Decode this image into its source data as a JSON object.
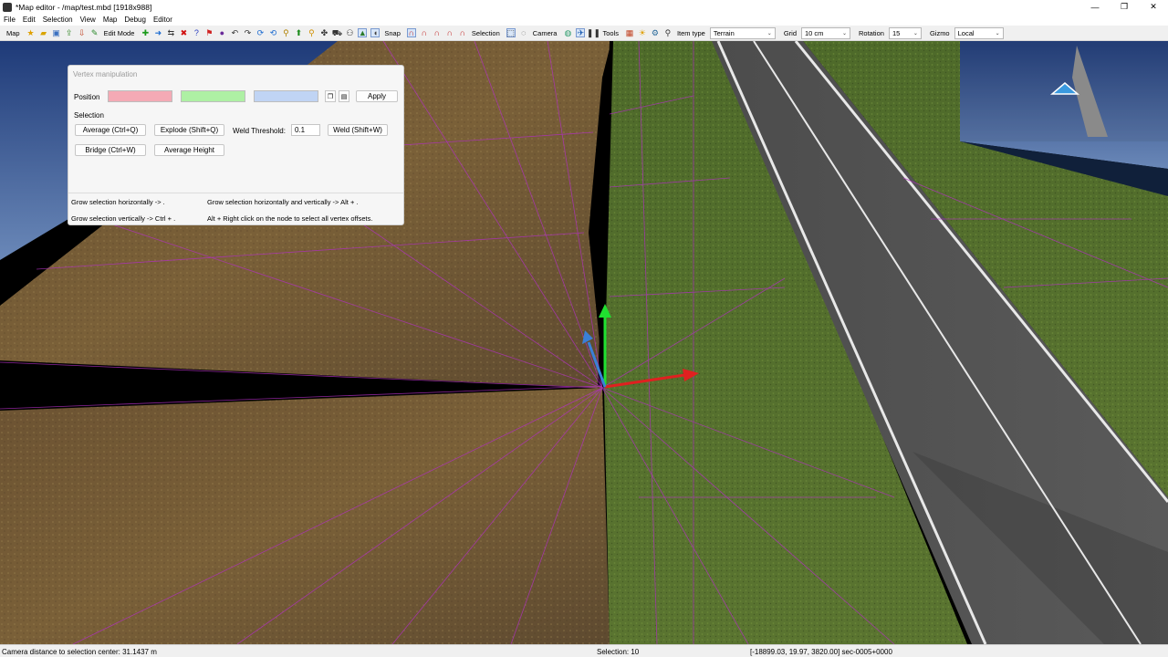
{
  "window": {
    "title": "*Map editor - /map/test.mbd [1918x988]",
    "min": "—",
    "max": "❐",
    "close": "✕"
  },
  "menu": [
    "File",
    "Edit",
    "Selection",
    "View",
    "Map",
    "Debug",
    "Editor"
  ],
  "toolbar": {
    "map_label": "Map",
    "edit_mode_label": "Edit Mode",
    "snap_label": "Snap",
    "selection_label": "Selection",
    "camera_label": "Camera",
    "tools_label": "Tools",
    "item_type_label": "Item type",
    "item_type_value": "Terrain",
    "grid_label": "Grid",
    "grid_value": "10 cm",
    "rotation_label": "Rotation",
    "rotation_value": "15",
    "gizmo_label": "Gizmo",
    "gizmo_value": "Local"
  },
  "panel": {
    "title": "Vertex manipulation",
    "position_label": "Position",
    "apply_label": "Apply",
    "selection_label": "Selection",
    "average_label": "Average (Ctrl+Q)",
    "explode_label": "Explode (Shift+Q)",
    "weld_threshold_label": "Weld Threshold:",
    "weld_threshold_value": "0.1",
    "weld_label": "Weld (Shift+W)",
    "bridge_label": "Bridge (Ctrl+W)",
    "average_height_label": "Average Height",
    "hints": [
      "Grow selection horizontally -> .",
      "Grow selection horizontally and vertically -> Alt + .",
      "Grow selection vertically -> Ctrl + .",
      "Alt + Right click on the node to select all vertex offsets."
    ],
    "colors": {
      "x": "#f4aab5",
      "y": "#aef0a4",
      "z": "#c0d4f4"
    }
  },
  "status": {
    "camera_distance": "Camera distance to selection center: 31.1437 m",
    "selection": "Selection: 10",
    "coords": "[-18899.03, 19.97, 3820.00] sec-0005+0000"
  }
}
